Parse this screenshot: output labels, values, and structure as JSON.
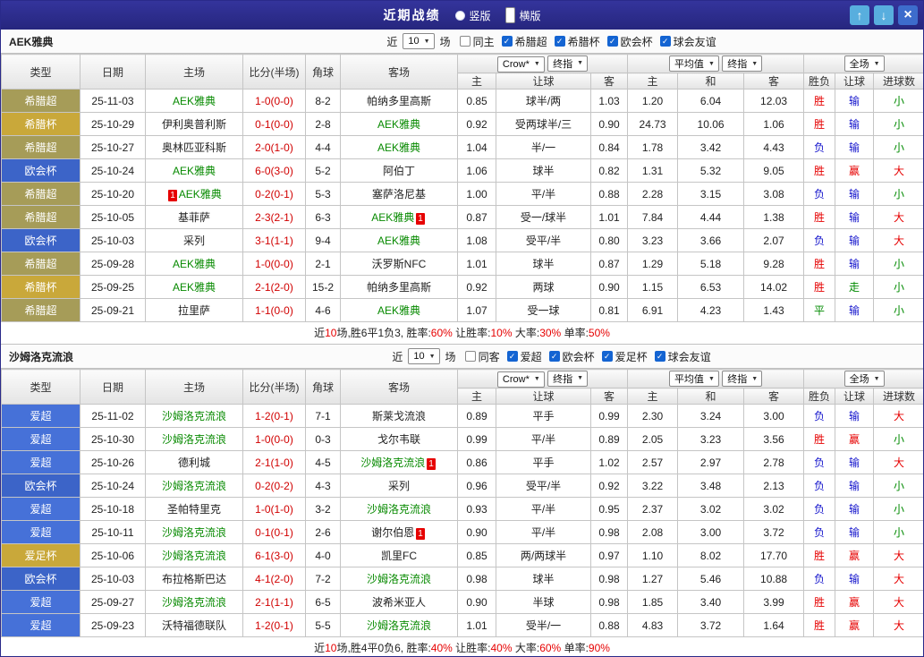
{
  "titlebar": {
    "title": "近期战绩",
    "options": [
      {
        "label": "竖版",
        "selected": false
      },
      {
        "label": "横版",
        "selected": true
      }
    ],
    "buttons": {
      "up": "↑",
      "down": "↓",
      "close": "×"
    }
  },
  "filter": {
    "near": "近",
    "count": "10",
    "matches": "场"
  },
  "table_header": {
    "type": "类型",
    "date": "日期",
    "home": "主场",
    "score": "比分(半场)",
    "corner": "角球",
    "away": "客场",
    "bk1": "Crow*",
    "idx1": "终指",
    "bk2": "平均值",
    "idx2": "终指",
    "bk3": "全场",
    "sub": [
      "主",
      "让球",
      "客",
      "主",
      "和",
      "客",
      "胜负",
      "让球",
      "进球数"
    ]
  },
  "league_colors": {
    "希腊超": "#a69c58",
    "希腊杯": "#c9a83a",
    "欧会杯": "#3c64c8",
    "爱超": "#4671d8",
    "爱足杯": "#c9a83a"
  },
  "colors": {
    "titlebar": "#2b2b8c",
    "win": "#e60000",
    "lose": "#1414cc",
    "push": "#008a00",
    "focal_team": "#078a00",
    "score": "#d10000"
  },
  "sections": [
    {
      "team": "AEK雅典",
      "filters": [
        {
          "label": "同主",
          "checked": false
        },
        {
          "label": "希腊超",
          "checked": true
        },
        {
          "label": "希腊杯",
          "checked": true
        },
        {
          "label": "欧会杯",
          "checked": true
        },
        {
          "label": "球会友谊",
          "checked": true
        }
      ],
      "rows": [
        {
          "lg": "希腊超",
          "date": "25-11-03",
          "home": "AEK雅典",
          "hg": true,
          "hpre": "",
          "score": "1-0(0-0)",
          "cn": "8-2",
          "away": "帕纳多里高斯",
          "ag": false,
          "apost": "",
          "odds": [
            "0.85",
            "球半/两",
            "1.03",
            "1.20",
            "6.04",
            "12.03"
          ],
          "res": [
            [
              "胜",
              "r"
            ],
            [
              "输",
              "b"
            ],
            [
              "小",
              "g"
            ]
          ]
        },
        {
          "lg": "希腊杯",
          "date": "25-10-29",
          "home": "伊利奥普利斯",
          "hg": false,
          "hpre": "",
          "score": "0-1(0-0)",
          "cn": "2-8",
          "away": "AEK雅典",
          "ag": true,
          "apost": "",
          "odds": [
            "0.92",
            "受两球半/三",
            "0.90",
            "24.73",
            "10.06",
            "1.06"
          ],
          "res": [
            [
              "胜",
              "r"
            ],
            [
              "输",
              "b"
            ],
            [
              "小",
              "g"
            ]
          ]
        },
        {
          "lg": "希腊超",
          "date": "25-10-27",
          "home": "奥林匹亚科斯",
          "hg": false,
          "hpre": "",
          "score": "2-0(1-0)",
          "cn": "4-4",
          "away": "AEK雅典",
          "ag": true,
          "apost": "",
          "odds": [
            "1.04",
            "半/一",
            "0.84",
            "1.78",
            "3.42",
            "4.43"
          ],
          "res": [
            [
              "负",
              "b"
            ],
            [
              "输",
              "b"
            ],
            [
              "小",
              "g"
            ]
          ]
        },
        {
          "lg": "欧会杯",
          "date": "25-10-24",
          "home": "AEK雅典",
          "hg": true,
          "hpre": "",
          "score": "6-0(3-0)",
          "cn": "5-2",
          "away": "阿伯丁",
          "ag": false,
          "apost": "",
          "odds": [
            "1.06",
            "球半",
            "0.82",
            "1.31",
            "5.32",
            "9.05"
          ],
          "res": [
            [
              "胜",
              "r"
            ],
            [
              "赢",
              "r"
            ],
            [
              "大",
              "r"
            ]
          ]
        },
        {
          "lg": "希腊超",
          "date": "25-10-20",
          "home": "AEK雅典",
          "hg": true,
          "hpre": "1",
          "score": "0-2(0-1)",
          "cn": "5-3",
          "away": "塞萨洛尼基",
          "ag": false,
          "apost": "",
          "odds": [
            "1.00",
            "平/半",
            "0.88",
            "2.28",
            "3.15",
            "3.08"
          ],
          "res": [
            [
              "负",
              "b"
            ],
            [
              "输",
              "b"
            ],
            [
              "小",
              "g"
            ]
          ]
        },
        {
          "lg": "希腊超",
          "date": "25-10-05",
          "home": "基菲萨",
          "hg": false,
          "hpre": "",
          "score": "2-3(2-1)",
          "cn": "6-3",
          "away": "AEK雅典",
          "ag": true,
          "apost": "1",
          "odds": [
            "0.87",
            "受一/球半",
            "1.01",
            "7.84",
            "4.44",
            "1.38"
          ],
          "res": [
            [
              "胜",
              "r"
            ],
            [
              "输",
              "b"
            ],
            [
              "大",
              "r"
            ]
          ]
        },
        {
          "lg": "欧会杯",
          "date": "25-10-03",
          "home": "采列",
          "hg": false,
          "hpre": "",
          "score": "3-1(1-1)",
          "cn": "9-4",
          "away": "AEK雅典",
          "ag": true,
          "apost": "",
          "odds": [
            "1.08",
            "受平/半",
            "0.80",
            "3.23",
            "3.66",
            "2.07"
          ],
          "res": [
            [
              "负",
              "b"
            ],
            [
              "输",
              "b"
            ],
            [
              "大",
              "r"
            ]
          ]
        },
        {
          "lg": "希腊超",
          "date": "25-09-28",
          "home": "AEK雅典",
          "hg": true,
          "hpre": "",
          "score": "1-0(0-0)",
          "cn": "2-1",
          "away": "沃罗斯NFC",
          "ag": false,
          "apost": "",
          "odds": [
            "1.01",
            "球半",
            "0.87",
            "1.29",
            "5.18",
            "9.28"
          ],
          "res": [
            [
              "胜",
              "r"
            ],
            [
              "输",
              "b"
            ],
            [
              "小",
              "g"
            ]
          ]
        },
        {
          "lg": "希腊杯",
          "date": "25-09-25",
          "home": "AEK雅典",
          "hg": true,
          "hpre": "",
          "score": "2-1(2-0)",
          "cn": "15-2",
          "away": "帕纳多里高斯",
          "ag": false,
          "apost": "",
          "odds": [
            "0.92",
            "两球",
            "0.90",
            "1.15",
            "6.53",
            "14.02"
          ],
          "res": [
            [
              "胜",
              "r"
            ],
            [
              "走",
              "g"
            ],
            [
              "小",
              "g"
            ]
          ]
        },
        {
          "lg": "希腊超",
          "date": "25-09-21",
          "home": "拉里萨",
          "hg": false,
          "hpre": "",
          "score": "1-1(0-0)",
          "cn": "4-6",
          "away": "AEK雅典",
          "ag": true,
          "apost": "",
          "odds": [
            "1.07",
            "受一球",
            "0.81",
            "6.91",
            "4.23",
            "1.43"
          ],
          "res": [
            [
              "平",
              "g"
            ],
            [
              "输",
              "b"
            ],
            [
              "小",
              "g"
            ]
          ]
        }
      ],
      "summary": [
        {
          "t": "近",
          "r": false
        },
        {
          "t": "10",
          "r": true
        },
        {
          "t": "场,胜6平1负3, 胜率:",
          "r": false
        },
        {
          "t": "60%",
          "r": true
        },
        {
          "t": " 让胜率:",
          "r": false
        },
        {
          "t": "10%",
          "r": true
        },
        {
          "t": " 大率:",
          "r": false
        },
        {
          "t": "30%",
          "r": true
        },
        {
          "t": " 单率:",
          "r": false
        },
        {
          "t": "50%",
          "r": true
        }
      ]
    },
    {
      "team": "沙姆洛克流浪",
      "filters": [
        {
          "label": "同客",
          "checked": false
        },
        {
          "label": "爱超",
          "checked": true
        },
        {
          "label": "欧会杯",
          "checked": true
        },
        {
          "label": "爱足杯",
          "checked": true
        },
        {
          "label": "球会友谊",
          "checked": true
        }
      ],
      "rows": [
        {
          "lg": "爱超",
          "date": "25-11-02",
          "home": "沙姆洛克流浪",
          "hg": true,
          "hpre": "",
          "score": "1-2(0-1)",
          "cn": "7-1",
          "away": "斯莱戈流浪",
          "ag": false,
          "apost": "",
          "odds": [
            "0.89",
            "平手",
            "0.99",
            "2.30",
            "3.24",
            "3.00"
          ],
          "res": [
            [
              "负",
              "b"
            ],
            [
              "输",
              "b"
            ],
            [
              "大",
              "r"
            ]
          ]
        },
        {
          "lg": "爱超",
          "date": "25-10-30",
          "home": "沙姆洛克流浪",
          "hg": true,
          "hpre": "",
          "score": "1-0(0-0)",
          "cn": "0-3",
          "away": "戈尔韦联",
          "ag": false,
          "apost": "",
          "odds": [
            "0.99",
            "平/半",
            "0.89",
            "2.05",
            "3.23",
            "3.56"
          ],
          "res": [
            [
              "胜",
              "r"
            ],
            [
              "赢",
              "r"
            ],
            [
              "小",
              "g"
            ]
          ]
        },
        {
          "lg": "爱超",
          "date": "25-10-26",
          "home": "德利城",
          "hg": false,
          "hpre": "",
          "score": "2-1(1-0)",
          "cn": "4-5",
          "away": "沙姆洛克流浪",
          "ag": true,
          "apost": "1",
          "odds": [
            "0.86",
            "平手",
            "1.02",
            "2.57",
            "2.97",
            "2.78"
          ],
          "res": [
            [
              "负",
              "b"
            ],
            [
              "输",
              "b"
            ],
            [
              "大",
              "r"
            ]
          ]
        },
        {
          "lg": "欧会杯",
          "date": "25-10-24",
          "home": "沙姆洛克流浪",
          "hg": true,
          "hpre": "",
          "score": "0-2(0-2)",
          "cn": "4-3",
          "away": "采列",
          "ag": false,
          "apost": "",
          "odds": [
            "0.96",
            "受平/半",
            "0.92",
            "3.22",
            "3.48",
            "2.13"
          ],
          "res": [
            [
              "负",
              "b"
            ],
            [
              "输",
              "b"
            ],
            [
              "小",
              "g"
            ]
          ]
        },
        {
          "lg": "爱超",
          "date": "25-10-18",
          "home": "圣帕特里克",
          "hg": false,
          "hpre": "",
          "score": "1-0(1-0)",
          "cn": "3-2",
          "away": "沙姆洛克流浪",
          "ag": true,
          "apost": "",
          "odds": [
            "0.93",
            "平/半",
            "0.95",
            "2.37",
            "3.02",
            "3.02"
          ],
          "res": [
            [
              "负",
              "b"
            ],
            [
              "输",
              "b"
            ],
            [
              "小",
              "g"
            ]
          ]
        },
        {
          "lg": "爱超",
          "date": "25-10-11",
          "home": "沙姆洛克流浪",
          "hg": true,
          "hpre": "",
          "score": "0-1(0-1)",
          "cn": "2-6",
          "away": "谢尔伯恩",
          "ag": false,
          "apost": "1",
          "odds": [
            "0.90",
            "平/半",
            "0.98",
            "2.08",
            "3.00",
            "3.72"
          ],
          "res": [
            [
              "负",
              "b"
            ],
            [
              "输",
              "b"
            ],
            [
              "小",
              "g"
            ]
          ]
        },
        {
          "lg": "爱足杯",
          "date": "25-10-06",
          "home": "沙姆洛克流浪",
          "hg": true,
          "hpre": "",
          "score": "6-1(3-0)",
          "cn": "4-0",
          "away": "凯里FC",
          "ag": false,
          "apost": "",
          "odds": [
            "0.85",
            "两/两球半",
            "0.97",
            "1.10",
            "8.02",
            "17.70"
          ],
          "res": [
            [
              "胜",
              "r"
            ],
            [
              "赢",
              "r"
            ],
            [
              "大",
              "r"
            ]
          ]
        },
        {
          "lg": "欧会杯",
          "date": "25-10-03",
          "home": "布拉格斯巴达",
          "hg": false,
          "hpre": "",
          "score": "4-1(2-0)",
          "cn": "7-2",
          "away": "沙姆洛克流浪",
          "ag": true,
          "apost": "",
          "odds": [
            "0.98",
            "球半",
            "0.98",
            "1.27",
            "5.46",
            "10.88"
          ],
          "res": [
            [
              "负",
              "b"
            ],
            [
              "输",
              "b"
            ],
            [
              "大",
              "r"
            ]
          ]
        },
        {
          "lg": "爱超",
          "date": "25-09-27",
          "home": "沙姆洛克流浪",
          "hg": true,
          "hpre": "",
          "score": "2-1(1-1)",
          "cn": "6-5",
          "away": "波希米亚人",
          "ag": false,
          "apost": "",
          "odds": [
            "0.90",
            "半球",
            "0.98",
            "1.85",
            "3.40",
            "3.99"
          ],
          "res": [
            [
              "胜",
              "r"
            ],
            [
              "赢",
              "r"
            ],
            [
              "大",
              "r"
            ]
          ]
        },
        {
          "lg": "爱超",
          "date": "25-09-23",
          "home": "沃特福德联队",
          "hg": false,
          "hpre": "",
          "score": "1-2(0-1)",
          "cn": "5-5",
          "away": "沙姆洛克流浪",
          "ag": true,
          "apost": "",
          "odds": [
            "1.01",
            "受半/一",
            "0.88",
            "4.83",
            "3.72",
            "1.64"
          ],
          "res": [
            [
              "胜",
              "r"
            ],
            [
              "赢",
              "r"
            ],
            [
              "大",
              "r"
            ]
          ]
        }
      ],
      "summary": [
        {
          "t": "近",
          "r": false
        },
        {
          "t": "10",
          "r": true
        },
        {
          "t": "场,胜4平0负6, 胜率:",
          "r": false
        },
        {
          "t": "40%",
          "r": true
        },
        {
          "t": " 让胜率:",
          "r": false
        },
        {
          "t": "40%",
          "r": true
        },
        {
          "t": " 大率:",
          "r": false
        },
        {
          "t": "60%",
          "r": true
        },
        {
          "t": " 单率:",
          "r": false
        },
        {
          "t": "90%",
          "r": true
        }
      ]
    }
  ]
}
